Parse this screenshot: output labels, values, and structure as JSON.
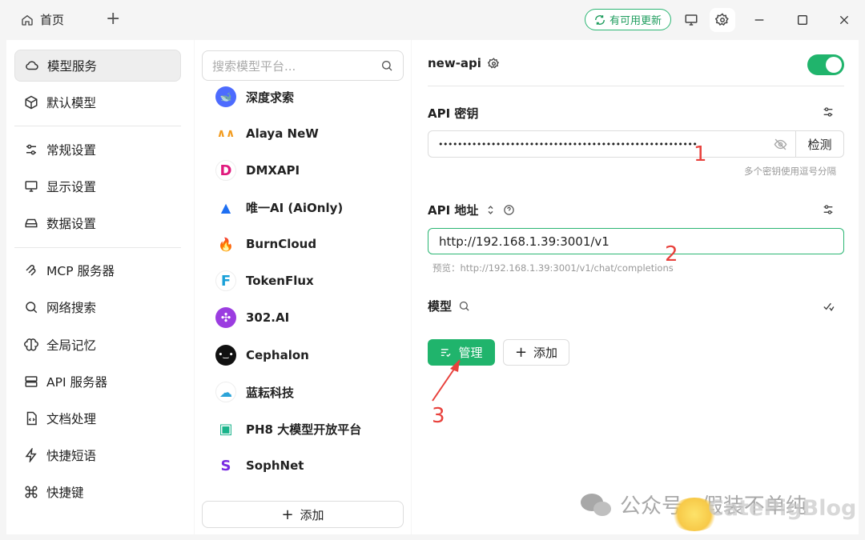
{
  "titlebar": {
    "home_tab": "首页",
    "update_badge": "有可用更新"
  },
  "nav": {
    "items": [
      {
        "label": "模型服务",
        "icon": "cloud-icon",
        "active": true
      },
      {
        "label": "默认模型",
        "icon": "cube-icon"
      },
      {
        "label": "常规设置",
        "icon": "sliders-icon"
      },
      {
        "label": "显示设置",
        "icon": "monitor-settings-icon"
      },
      {
        "label": "数据设置",
        "icon": "hard-drive-icon"
      },
      {
        "label": "MCP 服务器",
        "icon": "mcp-icon"
      },
      {
        "label": "网络搜索",
        "icon": "search-icon"
      },
      {
        "label": "全局记忆",
        "icon": "brain-icon"
      },
      {
        "label": "API 服务器",
        "icon": "server-icon"
      },
      {
        "label": "文档处理",
        "icon": "file-code-icon"
      },
      {
        "label": "快捷短语",
        "icon": "zap-icon"
      },
      {
        "label": "快捷键",
        "icon": "command-icon"
      }
    ]
  },
  "providers": {
    "search_placeholder": "搜索模型平台...",
    "items": [
      {
        "name": "深度求索",
        "color": "#4d6bfe",
        "glyph": "🐋"
      },
      {
        "name": "Alaya NeW",
        "color": "#f29b1d",
        "glyph": "∧∧"
      },
      {
        "name": "DMXAPI",
        "color": "#ffffff",
        "glyph": "D"
      },
      {
        "name": "唯一AI (AiOnly)",
        "color": "#ffffff",
        "glyph": "▲"
      },
      {
        "name": "BurnCloud",
        "color": "#ffffff",
        "glyph": "🔥"
      },
      {
        "name": "TokenFlux",
        "color": "#ffffff",
        "glyph": "F"
      },
      {
        "name": "302.AI",
        "color": "#9b3de0",
        "glyph": "✣"
      },
      {
        "name": "Cephalon",
        "color": "#111111",
        "glyph": "•‿•"
      },
      {
        "name": "蓝耘科技",
        "color": "#ffffff",
        "glyph": "☁"
      },
      {
        "name": "PH8 大模型开放平台",
        "color": "#ffffff",
        "glyph": "▣"
      },
      {
        "name": "SophNet",
        "color": "#ffffff",
        "glyph": "S"
      }
    ],
    "add_label": "添加"
  },
  "detail": {
    "provider_name": "new-api",
    "enabled": true,
    "api_key_label": "API 密钥",
    "api_key_value": "••••••••••••••••••••••••••••••••••••••••••••••••••••••",
    "check_label": "检测",
    "api_key_hint": "多个密钥使用逗号分隔",
    "api_url_label": "API 地址",
    "api_url_value": "http://192.168.1.39:3001/v1",
    "api_url_preview": "预览：http://192.168.1.39:3001/v1/chat/completions",
    "models_label": "模型",
    "manage_label": "管理",
    "add_label": "添加"
  },
  "annotations": {
    "a1": "1",
    "a2": "2",
    "a3": "3"
  },
  "watermark": {
    "text": "公众号 · 假装不单纯",
    "brand": "CatePigBlog"
  },
  "colors": {
    "accent": "#20b46c",
    "annotation": "#e8413c"
  }
}
